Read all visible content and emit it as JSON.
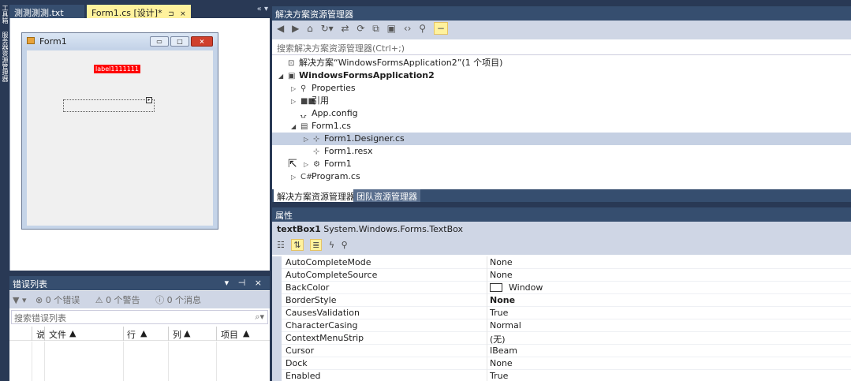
{
  "toolbox_strip": {
    "text1": "工具箱",
    "text2": "服务器资源管理器"
  },
  "doc_tabs": {
    "tab1": "測測測測.txt",
    "tab2": "Form1.cs [设计]*",
    "tab2_pin": "⊐",
    "tab2_close": "×",
    "controls": "« ▾"
  },
  "designer": {
    "form_title": "Form1",
    "label_text": "label1111111",
    "min_glyph": "▭",
    "max_glyph": "□",
    "close_glyph": "×"
  },
  "error_list": {
    "title": "错误列表",
    "header_controls": "▾ ⊣ ×",
    "filter": "▼ ▾",
    "errors": "0 个错误",
    "warnings": "0 个警告",
    "messages": "0 个消息",
    "search_placeholder": "搜索错误列表",
    "columns": [
      "说",
      "文件",
      "行",
      "列",
      "项目"
    ]
  },
  "solution_explorer": {
    "title": "解决方案资源管理器",
    "search_placeholder": "搜索解决方案资源管理器(Ctrl+;)",
    "tree": [
      {
        "label": "解决方案“WindowsFormsApplication2”(1 个项目)",
        "arrow": "",
        "icon": "⊡",
        "level": 0
      },
      {
        "label": "WindowsFormsApplication2",
        "arrow": "◢",
        "icon": "▣",
        "level": 0,
        "bold": true
      },
      {
        "label": "Properties",
        "arrow": "▷",
        "icon": "⚲",
        "level": 1
      },
      {
        "label": "引用",
        "arrow": "▷",
        "icon": "■■",
        "level": 1
      },
      {
        "label": "App.config",
        "arrow": "",
        "icon": "⍽",
        "level": 1
      },
      {
        "label": "Form1.cs",
        "arrow": "◢",
        "icon": "▤",
        "level": 1
      },
      {
        "label": "Form1.Designer.cs",
        "arrow": "▷",
        "icon": "⊹",
        "level": 2,
        "selected": true
      },
      {
        "label": "Form1.resx",
        "arrow": "",
        "icon": "⊹",
        "level": 2
      },
      {
        "label": "Form1",
        "arrow": "▷",
        "icon": "⚙",
        "level": 2
      },
      {
        "label": "Program.cs",
        "arrow": "▷",
        "icon": "C#",
        "level": 1
      }
    ],
    "tabs": [
      "解决方案资源管理器",
      "团队资源管理器"
    ]
  },
  "properties": {
    "title": "属性",
    "object_name": "textBox1",
    "object_type": "System.Windows.Forms.TextBox",
    "rows": [
      {
        "name": "AutoCompleteMode",
        "value": "None"
      },
      {
        "name": "AutoCompleteSource",
        "value": "None"
      },
      {
        "name": "BackColor",
        "value": "Window",
        "swatch": "#ffffff"
      },
      {
        "name": "BorderStyle",
        "value": "None",
        "bold": true
      },
      {
        "name": "CausesValidation",
        "value": "True"
      },
      {
        "name": "CharacterCasing",
        "value": "Normal"
      },
      {
        "name": "ContextMenuStrip",
        "value": "(无)"
      },
      {
        "name": "Cursor",
        "value": "IBeam"
      },
      {
        "name": "Dock",
        "value": "None"
      },
      {
        "name": "Enabled",
        "value": "True"
      }
    ]
  },
  "colors": {
    "frame": "#293955",
    "header": "#364e6f",
    "toolbar": "#cfd6e5",
    "active_tab": "#fff29d",
    "selection": "#c5d0e3"
  }
}
